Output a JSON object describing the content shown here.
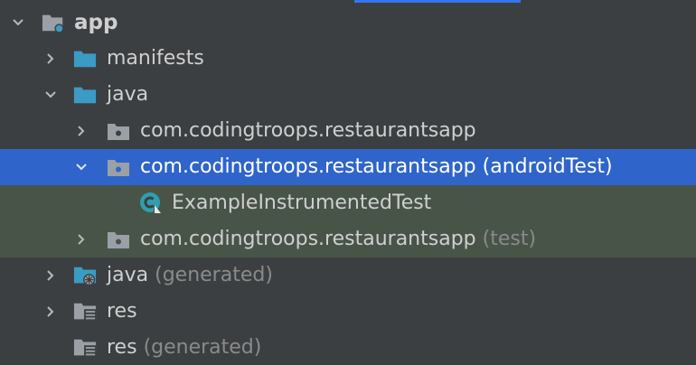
{
  "tree": {
    "rows": [
      {
        "label": "app",
        "suffix": ""
      },
      {
        "label": "manifests",
        "suffix": ""
      },
      {
        "label": "java",
        "suffix": ""
      },
      {
        "label": "com.codingtroops.restaurantsapp",
        "suffix": ""
      },
      {
        "label": "com.codingtroops.restaurantsapp",
        "suffix": "(androidTest)"
      },
      {
        "label": "ExampleInstrumentedTest",
        "suffix": ""
      },
      {
        "label": "com.codingtroops.restaurantsapp",
        "suffix": "(test)"
      },
      {
        "label": "java",
        "suffix": "(generated)"
      },
      {
        "label": "res",
        "suffix": ""
      },
      {
        "label": "res",
        "suffix": "(generated)"
      }
    ]
  },
  "colors": {
    "background": "#3c3f41",
    "selected": "#2f65ca",
    "highlight": "#485448",
    "folder_blue": "#3a9bc4",
    "package_gray": "#9aa0a6",
    "class_teal": "#2e9fb0"
  },
  "icons": {
    "expand": "chevron-right-icon",
    "collapse": "chevron-down-icon",
    "module": "module-folder-icon",
    "source_folder": "source-folder-icon",
    "package": "package-icon",
    "class": "test-class-icon",
    "generated": "generated-folder-icon",
    "resources": "resources-folder-icon"
  }
}
